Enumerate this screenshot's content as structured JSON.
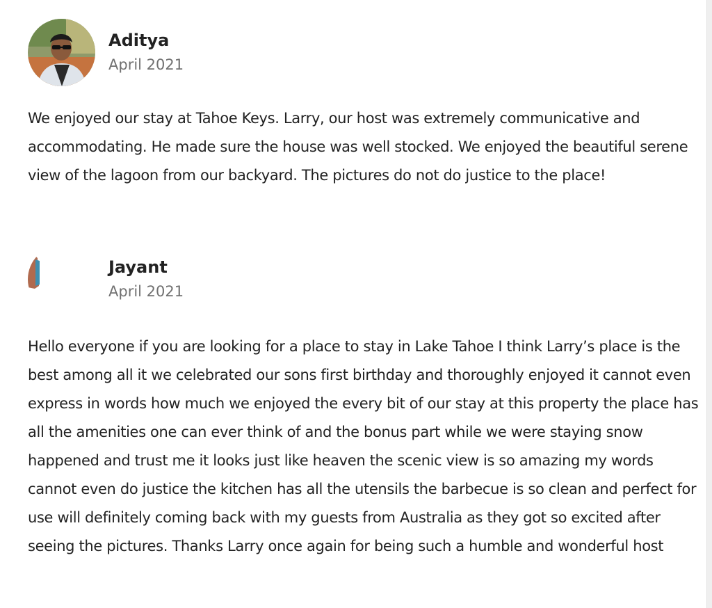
{
  "reviews": [
    {
      "name": "Aditya",
      "date": "April 2021",
      "avatar_icon": "user-photo-avatar",
      "text": "We enjoyed our stay at Tahoe Keys. Larry, our host was extremely communicative and accommodating. He made sure the house was well stocked. We enjoyed the beautiful serene view of the lagoon from our backyard. The pictures do not do justice to the place!"
    },
    {
      "name": "Jayant",
      "date": "April 2021",
      "avatar_icon": "user-photo-avatar",
      "text": "Hello everyone if you are looking for a place to stay in Lake Tahoe I think Larry’s place is the best among all it we celebrated our sons first birthday and thoroughly enjoyed it cannot even express in words how much we enjoyed the every bit of our stay at this property the place has all the amenities one can ever think of and the bonus part while we were staying snow happened and trust me it looks just like heaven the scenic view is so amazing my words cannot even do justice the kitchen has all the utensils the barbecue is so clean and perfect for use will definitely coming back with my guests from Australia as they got so excited after seeing the pictures. Thanks Larry once again for being such a humble and wonderful host"
    }
  ],
  "colors": {
    "text": "#222222",
    "muted": "#717171",
    "background": "#ffffff"
  }
}
